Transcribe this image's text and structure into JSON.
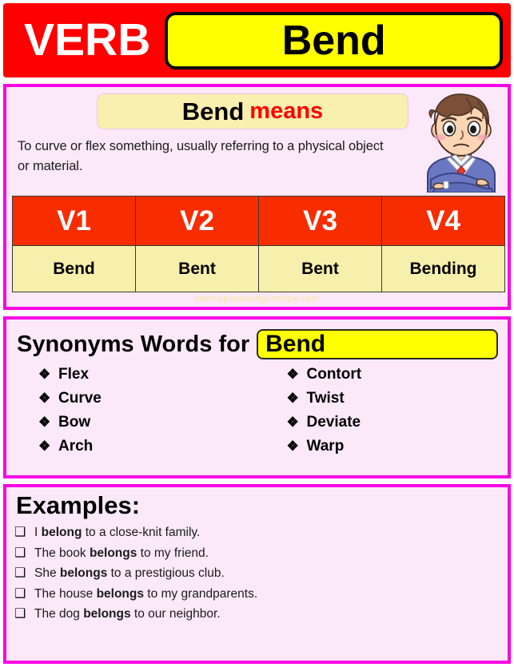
{
  "header": {
    "category_label": "VERB",
    "word": "Bend"
  },
  "meaning": {
    "word": "Bend",
    "means_label": "means",
    "definition": "To curve or flex something, usually referring to a physical object or material.",
    "mascot": "thinking-man-illustration"
  },
  "verb_table": {
    "headers": [
      "V1",
      "V2",
      "V3",
      "V4"
    ],
    "forms": [
      "Bend",
      "Bent",
      "Bent",
      "Bending"
    ]
  },
  "watermark": "www.spokenenglishtips.com",
  "synonyms": {
    "title": "Synonyms Words for",
    "word": "Bend",
    "bullet": "❖",
    "column_left": [
      "Flex",
      "Curve",
      "Bow",
      "Arch"
    ],
    "column_right": [
      "Contort",
      "Twist",
      "Deviate",
      "Warp"
    ]
  },
  "examples": {
    "title": "Examples:",
    "bullet": "❑",
    "items": [
      {
        "before": "I ",
        "bold": "belong",
        "after": " to a close-knit family."
      },
      {
        "before": "The book ",
        "bold": "belongs",
        "after": " to my friend."
      },
      {
        "before": "She ",
        "bold": "belongs",
        "after": " to a prestigious club."
      },
      {
        "before": "The house ",
        "bold": "belongs",
        "after": " to my grandparents."
      },
      {
        "before": "The dog ",
        "bold": "belongs",
        "after": " to our neighbor."
      }
    ]
  },
  "colors": {
    "header_red": "#FF0000",
    "table_header_red": "#F72D00",
    "highlight_yellow": "#FFFF00",
    "soft_yellow": "#F7F0AC",
    "panel_border_magenta": "#FA00E6",
    "panel_bg_pink": "#FBE9FA",
    "means_accent_red": "#FF0000"
  }
}
